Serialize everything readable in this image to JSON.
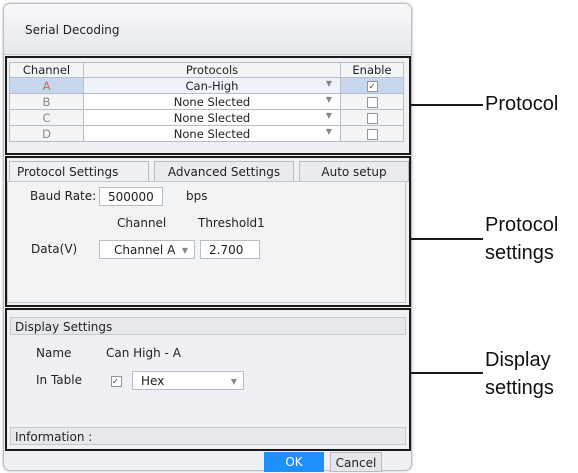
{
  "window": {
    "title": "Serial Decoding"
  },
  "table": {
    "headers": [
      "Channel",
      "Protocols",
      "Enable"
    ],
    "rows": [
      {
        "channel": "A",
        "protocol": "Can-High",
        "enabled": true
      },
      {
        "channel": "B",
        "protocol": "None Slected",
        "enabled": false
      },
      {
        "channel": "C",
        "protocol": "None Slected",
        "enabled": false
      },
      {
        "channel": "D",
        "protocol": "None Slected",
        "enabled": false
      }
    ]
  },
  "tabs": [
    "Protocol Settings",
    "Advanced Settings",
    "Auto setup"
  ],
  "protocol_settings": {
    "baud_label": "Baud Rate:",
    "baud_value": "500000",
    "baud_unit": "bps",
    "col_channel": "Channel",
    "col_threshold": "Threshold1",
    "data_label": "Data(V)",
    "data_channel": "Channel A",
    "threshold_value": "2.700"
  },
  "display_settings": {
    "heading": "Display Settings",
    "name_label": "Name",
    "name_value": "Can High - A",
    "in_table_label": "In Table",
    "in_table_checked": true,
    "format_value": "Hex"
  },
  "information_label": "Information :",
  "buttons": {
    "ok": "OK",
    "cancel": "Cancel"
  },
  "callouts": {
    "protocol": "Protocol",
    "protocol_settings_1": "Protocol",
    "protocol_settings_2": "settings",
    "display_1": "Display",
    "display_2": "settings"
  },
  "colors": {
    "selected_row": "#c7d7ee",
    "ok_button": "#1e90ff",
    "frame": "#1a1a1a"
  }
}
